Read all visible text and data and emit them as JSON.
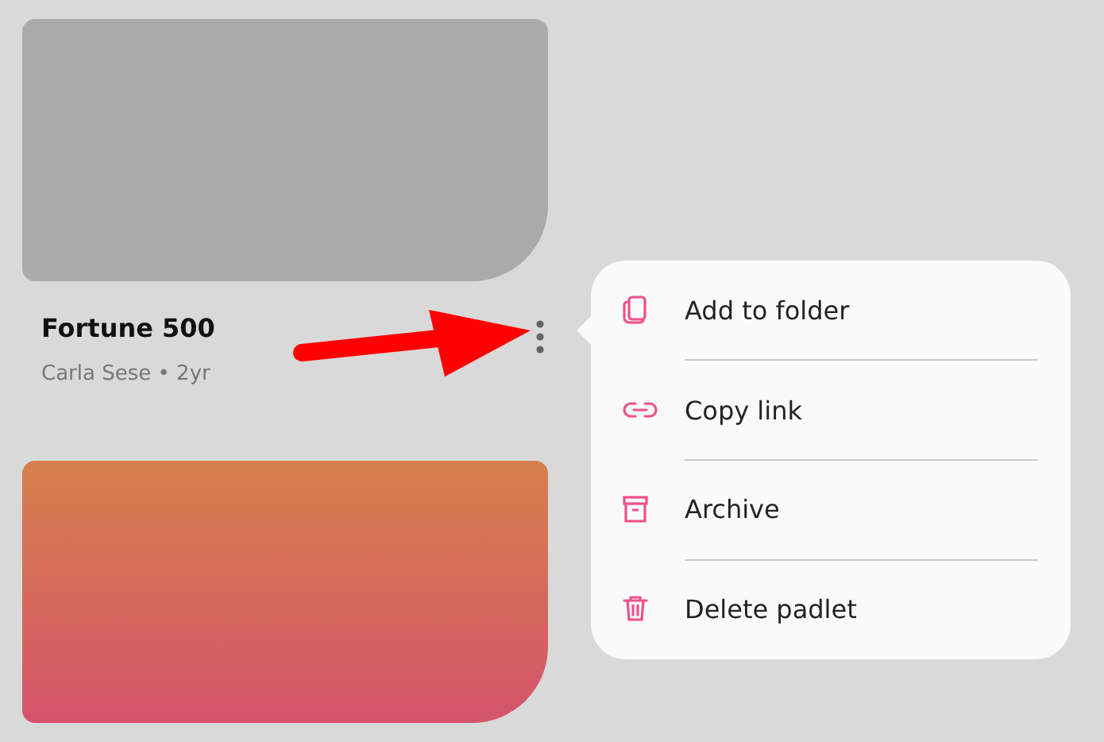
{
  "padlets": [
    {
      "kind": "plain",
      "title": "Fortune 500",
      "byline": "Carla Sese • 2yr",
      "menu_open": true
    },
    {
      "kind": "gradient"
    }
  ],
  "menu": {
    "items": [
      {
        "kind": "folder",
        "label": "Add to folder"
      },
      {
        "kind": "link",
        "label": "Copy link"
      },
      {
        "kind": "archive",
        "label": "Archive"
      },
      {
        "kind": "trash",
        "label": "Delete padlet"
      }
    ]
  }
}
